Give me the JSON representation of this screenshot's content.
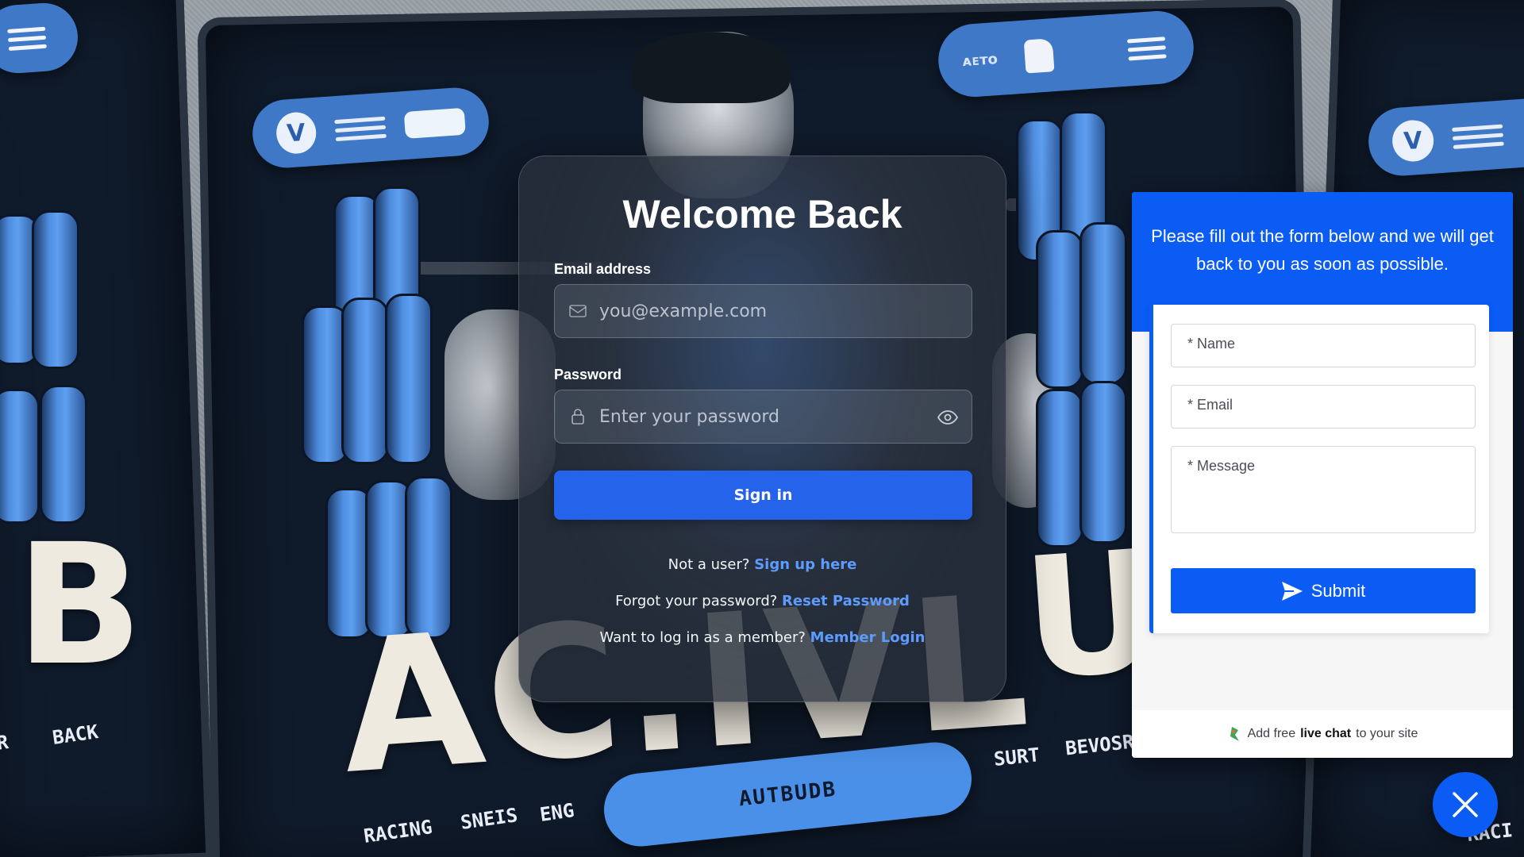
{
  "background": {
    "bottom_words": [
      "RACING",
      "SNEIS",
      "ENG",
      "SURT",
      "BEVOSR",
      "RACI"
    ],
    "left_words": [
      "R",
      "BACK"
    ],
    "bar_label": "AUTBUDB",
    "pill_label": "ᴀᴇᴛᴏ",
    "logo_glyph": "V",
    "big_word_main": "AC.IVL",
    "big_word_left": "B",
    "big_word_right": "UI"
  },
  "login": {
    "title": "Welcome Back",
    "email_label": "Email address",
    "email_placeholder": "you@example.com",
    "password_label": "Password",
    "password_placeholder": "Enter your password",
    "signin_label": "Sign in",
    "signup_prompt": "Not a user?",
    "signup_link": "Sign up here",
    "forgot_prompt": "Forgot your password?",
    "forgot_link": "Reset Password",
    "member_prompt": "Want to log in as a member?",
    "member_link": "Member Login"
  },
  "widget": {
    "header_text": "Please fill out the form below and we will get back to you as soon as possible.",
    "name_placeholder": "* Name",
    "email_placeholder": "* Email",
    "message_placeholder": "* Message",
    "submit_label": "Submit",
    "footer_prefix": "Add free",
    "footer_bold": "live chat",
    "footer_suffix": "to your site",
    "accent_color": "#0a5cf5"
  },
  "icons": {
    "email": "envelope-icon",
    "password": "lock-icon",
    "toggle": "eye-icon",
    "submit": "send-icon",
    "close": "close-icon"
  }
}
